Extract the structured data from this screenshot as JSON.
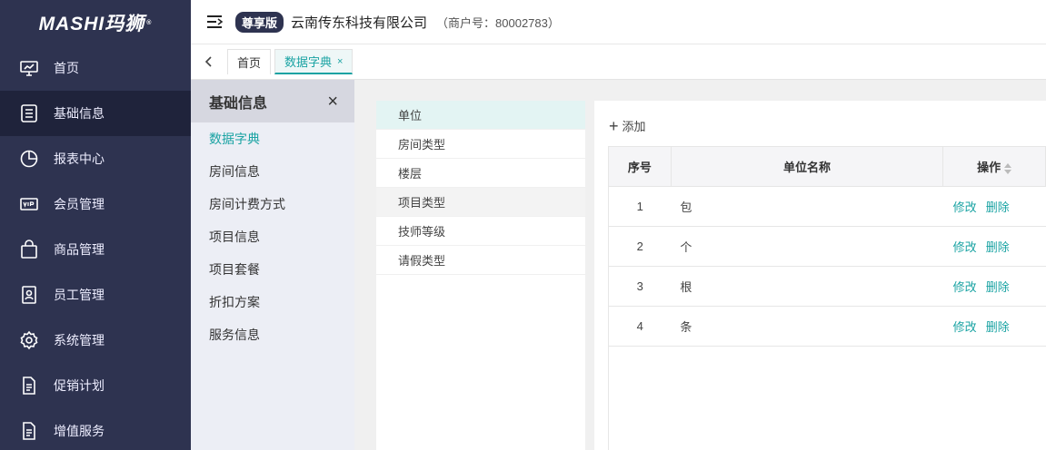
{
  "brand": {
    "logo_text": "MASHI玛狮",
    "trademark": "®"
  },
  "nav": {
    "items": [
      {
        "label": "首页",
        "icon": "dashboard-icon"
      },
      {
        "label": "基础信息",
        "icon": "document-icon",
        "active": true
      },
      {
        "label": "报表中心",
        "icon": "pie-chart-icon"
      },
      {
        "label": "会员管理",
        "icon": "vip-card-icon"
      },
      {
        "label": "商品管理",
        "icon": "shopping-bag-icon"
      },
      {
        "label": "员工管理",
        "icon": "staff-badge-icon"
      },
      {
        "label": "系统管理",
        "icon": "gear-icon"
      },
      {
        "label": "促销计划",
        "icon": "file-icon"
      },
      {
        "label": "增值服务",
        "icon": "file-icon"
      }
    ]
  },
  "header": {
    "edition_badge": "尊享版",
    "company": "云南传东科技有限公司",
    "merchant": "（商户号：80002783）"
  },
  "tabs": [
    {
      "label": "首页",
      "active": false
    },
    {
      "label": "数据字典",
      "active": true,
      "close": "×"
    }
  ],
  "subpanel": {
    "title": "基础信息",
    "close": "×",
    "items": [
      {
        "label": "数据字典",
        "active": true
      },
      {
        "label": "房间信息"
      },
      {
        "label": "房间计费方式"
      },
      {
        "label": "项目信息"
      },
      {
        "label": "项目套餐"
      },
      {
        "label": "折扣方案"
      },
      {
        "label": "服务信息"
      }
    ]
  },
  "dict_types": [
    {
      "label": "单位",
      "active": true
    },
    {
      "label": "房间类型"
    },
    {
      "label": "楼层"
    },
    {
      "label": "项目类型",
      "hover": true
    },
    {
      "label": "技师等级"
    },
    {
      "label": "请假类型"
    }
  ],
  "table": {
    "add_label": "添加",
    "columns": [
      "序号",
      "单位名称",
      "操作"
    ],
    "rows": [
      {
        "no": "1",
        "name": "包"
      },
      {
        "no": "2",
        "name": "个"
      },
      {
        "no": "3",
        "name": "根"
      },
      {
        "no": "4",
        "name": "条"
      }
    ],
    "edit_label": "修改",
    "delete_label": "删除"
  },
  "colors": {
    "nav_bg": "#2e3350",
    "accent": "#1aa3a3"
  }
}
